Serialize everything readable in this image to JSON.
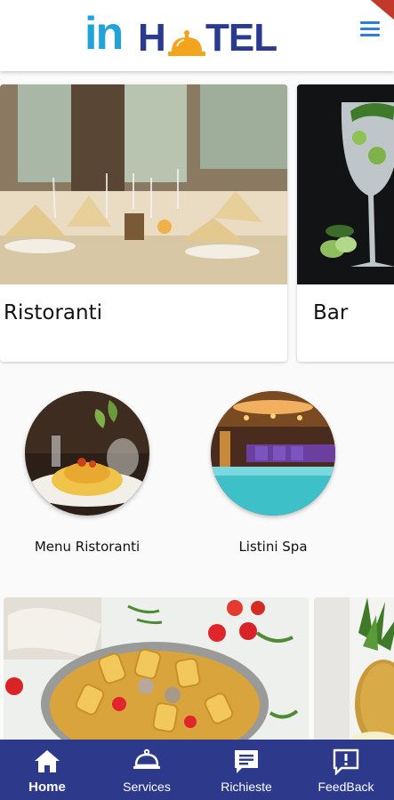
{
  "brand": {
    "logo_in": "in",
    "logo_h": "H",
    "logo_tel": "TEL",
    "colors": {
      "in": "#1fa3d8",
      "hotel": "#2a3b8f",
      "bell": "#f2a41c"
    }
  },
  "header": {
    "menu_icon": "hamburger-menu-icon"
  },
  "carousel": {
    "cards": [
      {
        "label": "Ristoranti",
        "image": "restaurant-table-photo"
      },
      {
        "label": "Bar",
        "image": "cocktail-glass-photo"
      }
    ]
  },
  "shortcuts": [
    {
      "label": "Menu Ristoranti",
      "image": "pasta-dish-photo"
    },
    {
      "label": "Listini Spa",
      "image": "spa-pool-photo"
    }
  ],
  "lower_cards": [
    {
      "image": "pasta-pan-photo"
    },
    {
      "image": "pineapple-photo"
    }
  ],
  "bottom_nav": {
    "background": "#2d3a8c",
    "items": [
      {
        "label": "Home",
        "icon": "home-icon",
        "active": true
      },
      {
        "label": "Services",
        "icon": "service-bell-icon",
        "active": false
      },
      {
        "label": "Richieste",
        "icon": "chat-bubble-icon",
        "active": false
      },
      {
        "label": "FeedBack",
        "icon": "feedback-alert-icon",
        "active": false
      }
    ]
  }
}
